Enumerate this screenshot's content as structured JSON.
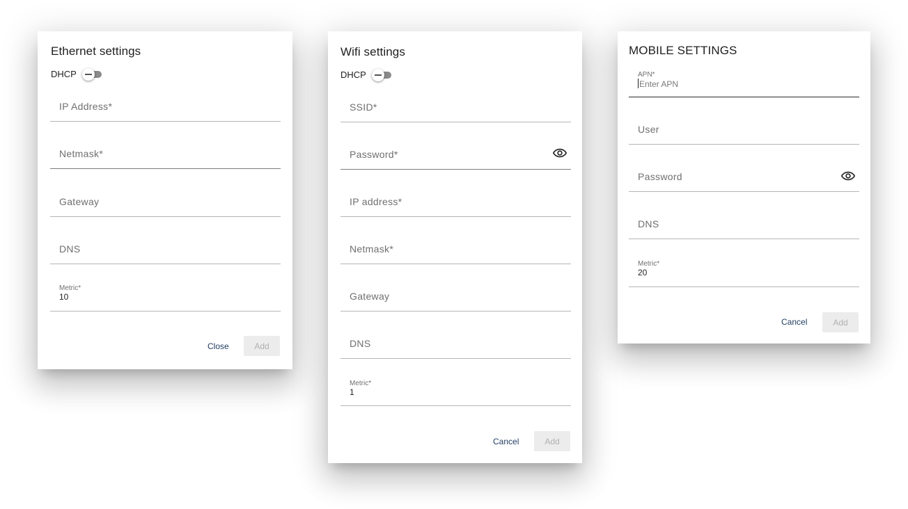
{
  "ethernet": {
    "title": "Ethernet settings",
    "dhcp_label": "DHCP",
    "fields": {
      "ip_address": {
        "placeholder": "IP Address*"
      },
      "netmask": {
        "placeholder": "Netmask*"
      },
      "gateway": {
        "placeholder": "Gateway"
      },
      "dns": {
        "placeholder": "DNS"
      },
      "metric": {
        "label": "Metric*",
        "value": "10"
      }
    },
    "close_label": "Close",
    "add_label": "Add"
  },
  "wifi": {
    "title": "Wifi settings",
    "dhcp_label": "DHCP",
    "fields": {
      "ssid": {
        "placeholder": "SSID*"
      },
      "password": {
        "placeholder": "Password*"
      },
      "ip_address": {
        "placeholder": "IP address*"
      },
      "netmask": {
        "placeholder": "Netmask*"
      },
      "gateway": {
        "placeholder": "Gateway"
      },
      "dns": {
        "placeholder": "DNS"
      },
      "metric": {
        "label": "Metric*",
        "value": "1"
      }
    },
    "cancel_label": "Cancel",
    "add_label": "Add"
  },
  "mobile": {
    "title": "MOBILE SETTINGS",
    "fields": {
      "apn": {
        "label": "APN*",
        "placeholder": "Enter APN"
      },
      "user": {
        "placeholder": "User"
      },
      "password": {
        "placeholder": "Password"
      },
      "dns": {
        "placeholder": "DNS"
      },
      "metric": {
        "label": "Metric*",
        "value": "20"
      }
    },
    "cancel_label": "Cancel",
    "add_label": "Add"
  },
  "icons": {
    "password_visibility": "eye-icon"
  },
  "colors": {
    "text_button": "#1d3a5f",
    "disabled_button_bg": "#ececec",
    "disabled_button_text": "#b0b0b0"
  }
}
